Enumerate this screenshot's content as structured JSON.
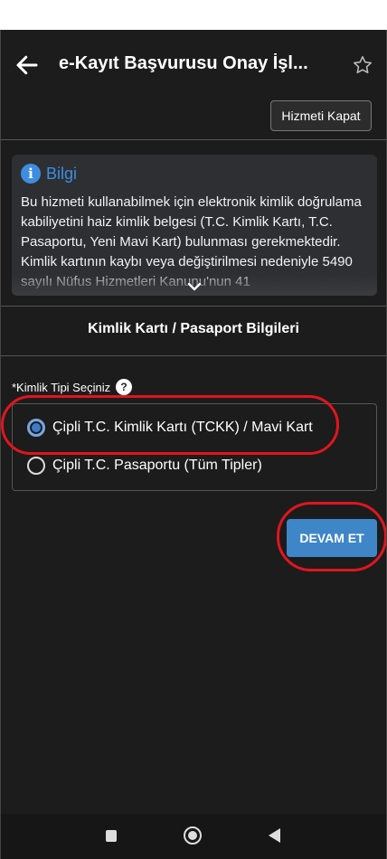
{
  "appbar": {
    "title": "e-Kayıt Başvurusu Onay İşl...",
    "back_icon": "arrow-left-icon",
    "favorite_icon": "star-outline-icon"
  },
  "close_button_label": "Hizmeti Kapat",
  "info": {
    "title": "Bilgi",
    "icon": "info-icon",
    "text": "Bu hizmeti kullanabilmek için elektronik kimlik doğrulama kabiliyetini haiz kimlik belgesi (T.C. Kimlik Kartı, T.C. Pasaportu, Yeni Mavi Kart) bulunması gerekmektedir. Kimlik kartının kaybı veya değiştirilmesi nedeniyle 5490 sayılı Nüfus Hizmetleri Kanunu'nun 41",
    "expand_icon": "chevron-down-icon"
  },
  "section_title": "Kimlik Kartı / Pasaport Bilgileri",
  "identity_type": {
    "label": "*Kimlik Tipi Seçiniz",
    "help_icon": "help-icon",
    "options": [
      {
        "label": "Çipli T.C. Kimlik Kartı (TCKK) / Mavi Kart",
        "selected": true
      },
      {
        "label": "Çipli T.C. Pasaportu (Tüm Tipler)",
        "selected": false
      }
    ]
  },
  "continue_button_label": "DEVAM ET",
  "colors": {
    "accent": "#3f86c9",
    "highlight_annotation": "#e0151f",
    "background": "#1c1c1c"
  }
}
